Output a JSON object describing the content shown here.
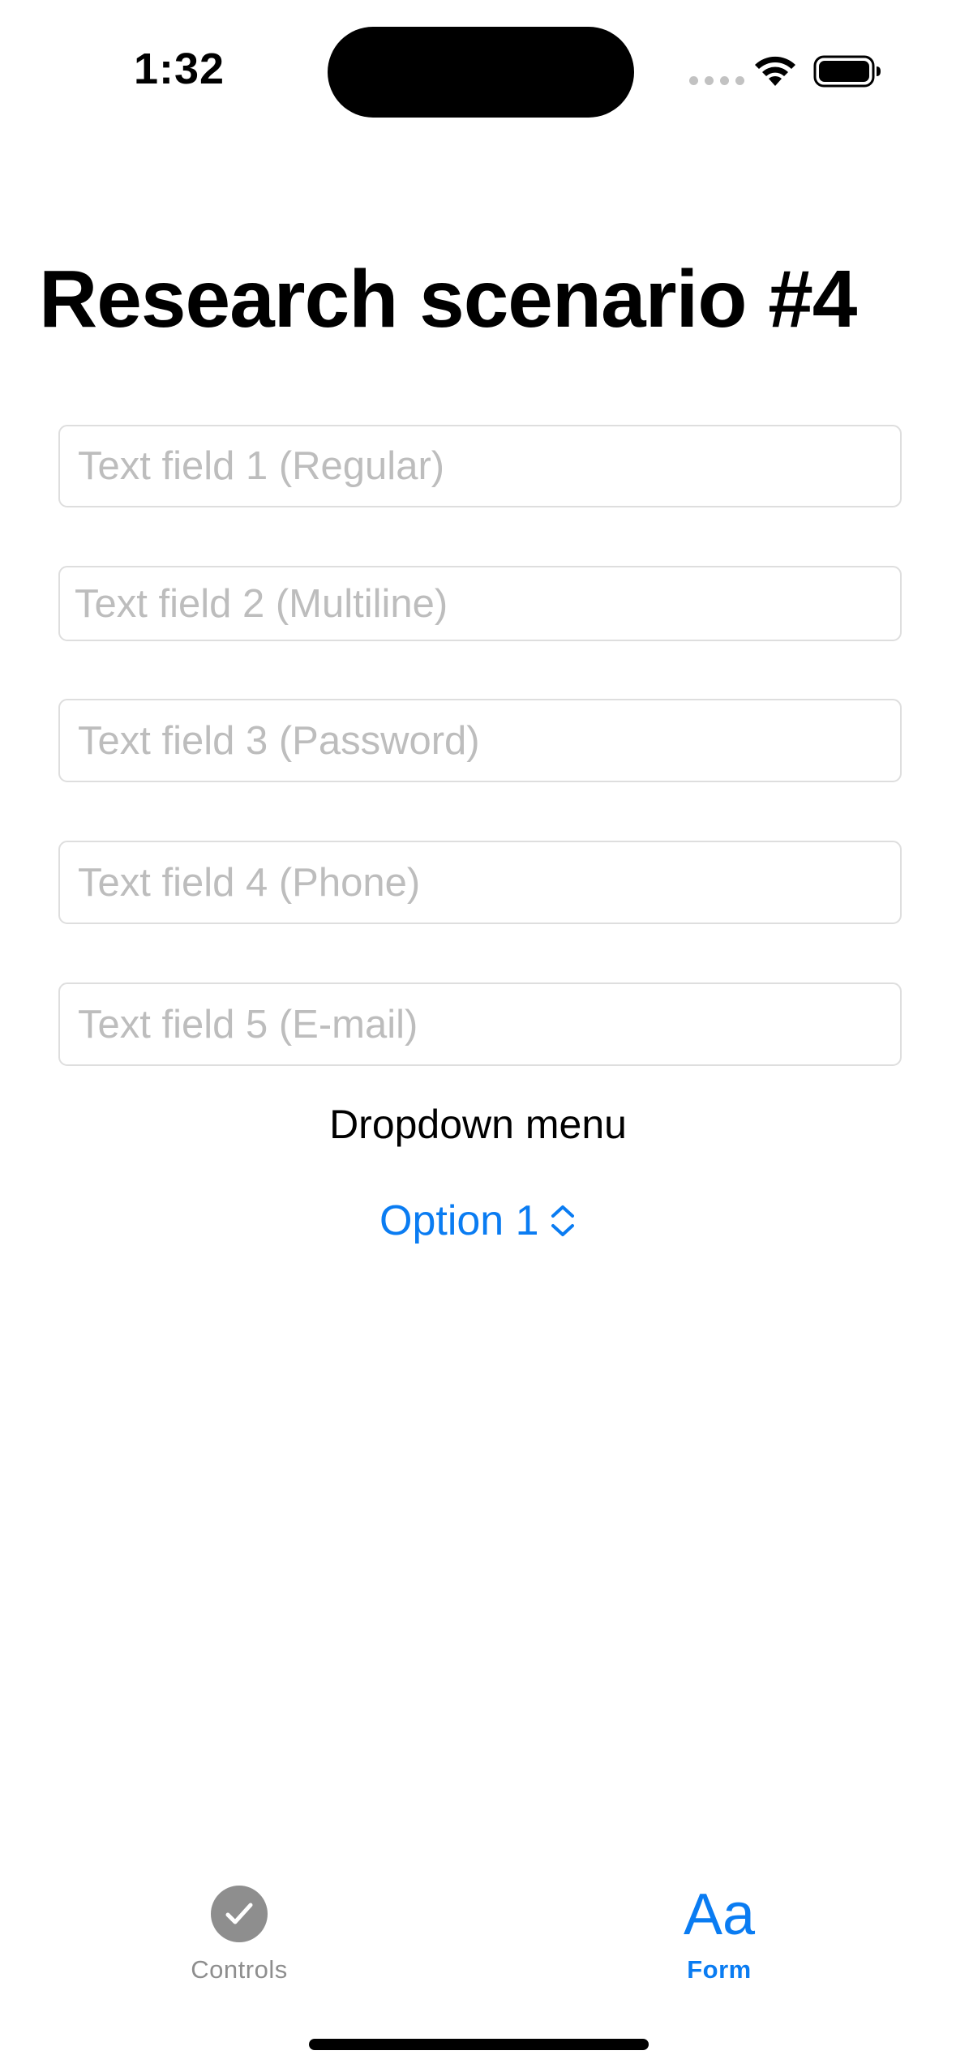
{
  "status_bar": {
    "time": "1:32",
    "icons": [
      "cellular-signal-icon",
      "wifi-icon",
      "battery-icon"
    ]
  },
  "page": {
    "title": "Research scenario #4"
  },
  "form": {
    "fields": [
      {
        "placeholder": "Text field 1 (Regular)",
        "value": ""
      },
      {
        "placeholder": "Text field 2 (Multiline)",
        "value": ""
      },
      {
        "placeholder": "Text field 3 (Password)",
        "value": ""
      },
      {
        "placeholder": "Text field 4 (Phone)",
        "value": ""
      },
      {
        "placeholder": "Text field 5 (E-mail)",
        "value": ""
      }
    ],
    "dropdown_label": "Dropdown menu",
    "dropdown_value": "Option 1"
  },
  "tab_bar": {
    "items": [
      {
        "label": "Controls",
        "icon": "checkmark-circle-icon",
        "selected": false
      },
      {
        "label": "Form",
        "icon": "text-format-icon",
        "glyph": "Aa",
        "selected": true
      }
    ]
  },
  "colors": {
    "accent": "#0a7cf2",
    "placeholder": "#bdbdbd",
    "field_border": "#dedede",
    "inactive_tab": "#8e8e8e"
  }
}
